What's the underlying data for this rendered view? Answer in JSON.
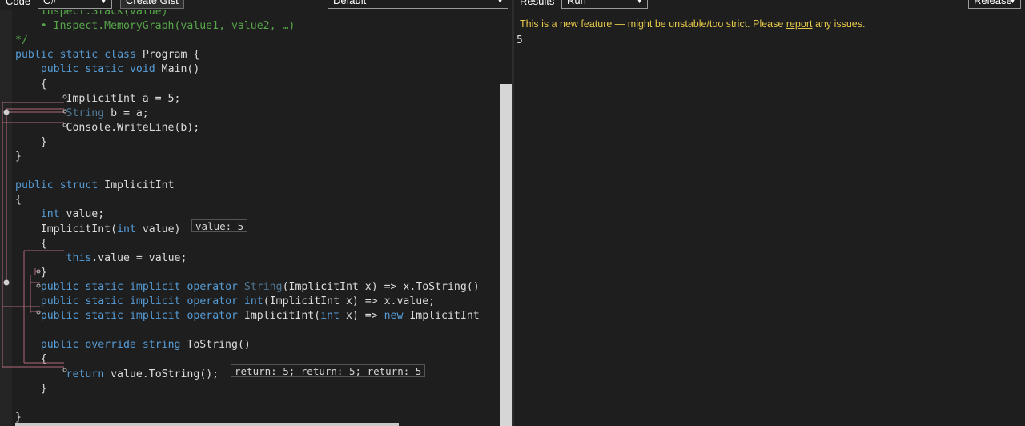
{
  "toolbar": {
    "code_label": "Code",
    "language": "C#",
    "create_gist": "Create Gist",
    "mode": "Default",
    "results_label": "Results",
    "run_mode": "Run",
    "build": "Release"
  },
  "code": {
    "lines": [
      "    Inspect.Stack(value)",
      "    • Inspect.MemoryGraph(value1, value2, …)",
      "*/",
      "public static class Program {",
      "    public static void Main()",
      "    {",
      "        ImplicitInt a = 5;",
      "        String b = a;",
      "        Console.WriteLine(b);",
      "    }",
      "}",
      "",
      "public struct ImplicitInt",
      "{",
      "    int value;",
      "    ImplicitInt(int value)",
      "    {",
      "        this.value = value;",
      "    }",
      "    public static implicit operator String(ImplicitInt x) => x.ToString()",
      "    public static implicit operator int(ImplicitInt x) => x.value;",
      "    public static implicit operator ImplicitInt(int x) => new ImplicitInt",
      "",
      "    public override string ToString()",
      "    {",
      "        return value.ToString();",
      "    }",
      "",
      "}"
    ],
    "badge_ctor": "value: 5",
    "badge_return": "return: 5; return: 5; return: 5"
  },
  "results": {
    "notice_before": "This is a new feature — might be unstable/too strict. Please ",
    "notice_link": "report",
    "notice_after": " any issues.",
    "output": "5"
  },
  "colors": {
    "keyword": "#569cd6",
    "type": "#4ec9b0",
    "comment": "#57a64a",
    "notice": "#e6c84a",
    "flow_line": "#b06a78",
    "flow_node": "#c0c0c0"
  }
}
